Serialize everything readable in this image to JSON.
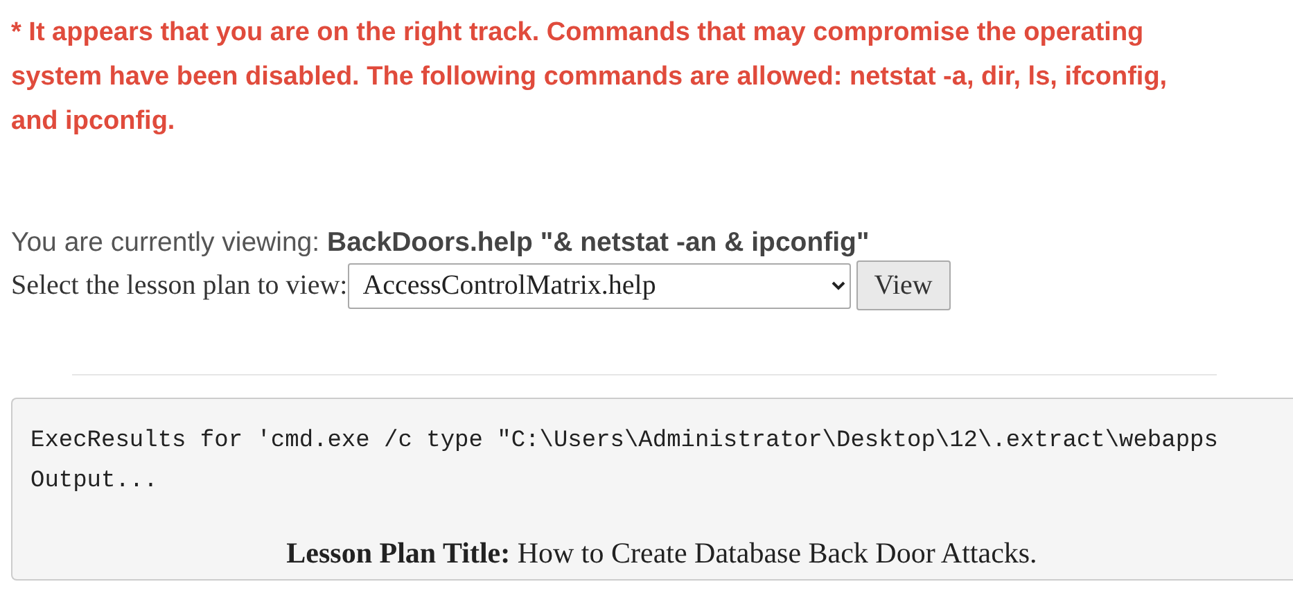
{
  "alert": "* It appears that you are on the right track. Commands that may compromise the operating system have been disabled. The following commands are allowed: netstat -a, dir, ls, ifconfig, and ipconfig.",
  "viewing": "You are currently viewing: **BackDoors.help \"& netstat -an & ipconfig\"**",
  "lesson_select": {
    "label": "Select the lesson plan to view:",
    "value": "AccessControlMatrix.help",
    "button": "View"
  },
  "output": {
    "lines": [
      "ExecResults for 'cmd.exe /c type \"C:\\Users\\Administrator\\Desktop\\12\\.extract\\webapps",
      "Output..."
    ],
    "title": "**Lesson Plan Title:** How to Create Database Back Door Attacks."
  }
}
